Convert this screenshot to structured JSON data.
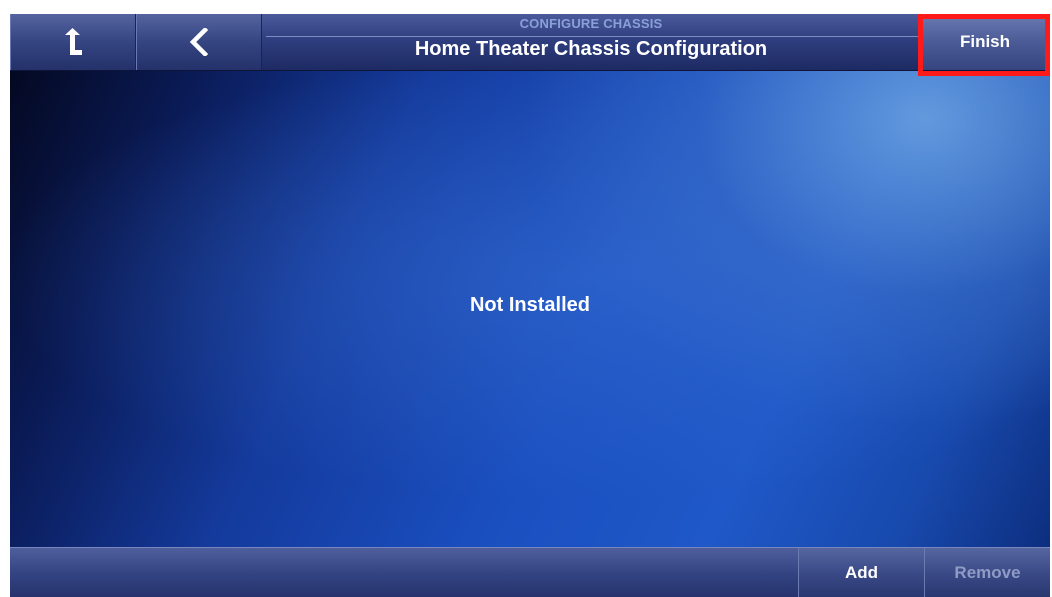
{
  "header": {
    "up_icon": "up-level-icon",
    "back_icon": "chevron-left-icon",
    "subtitle": "CONFIGURE CHASSIS",
    "title": "Home Theater Chassis Configuration",
    "finish_label": "Finish"
  },
  "main": {
    "status_text": "Not Installed"
  },
  "footer": {
    "add_label": "Add",
    "remove_label": "Remove"
  },
  "colors": {
    "highlight": "#ff1a1a",
    "accent_blue": "#1a4fc0"
  }
}
